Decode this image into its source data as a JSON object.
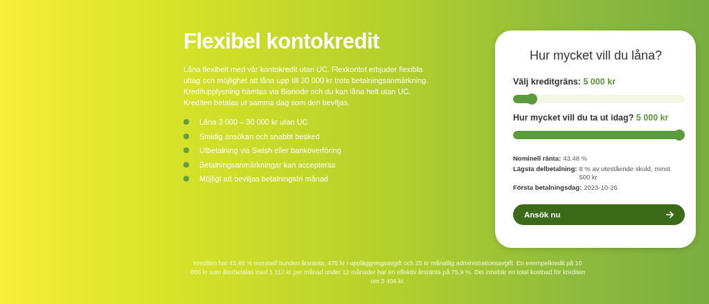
{
  "hero": {
    "title": "Flexibel kontokredit",
    "description": "Låna flexibelt med vår kontokredit utan UC. Flexkontot erbjuder flexibla uttag och möjlighet att låna upp till 30 000 kr trots betalningsanmärkning. Kreditupplysning hämtas via Bisnode och du kan låna helt utan UC. Krediten betalas ut samma dag som den beviljas.",
    "features": [
      "Låna 3 000 – 30 000 kr utan UC",
      "Smidig ansökan och snabbt besked",
      "Utbetalning via Swish eller banköverföring",
      "Betalningsanmärkningar kan accepteras",
      "Möjligt att beviljas betalningsfri månad"
    ]
  },
  "calculator": {
    "title": "Hur mycket vill du låna?",
    "sliders": [
      {
        "label": "Välj kreditgräns:",
        "value": "5 000 kr",
        "level": 0.08
      },
      {
        "label": "Hur mycket vill du ta ut idag?",
        "value": "5 000 kr",
        "level": 1
      }
    ],
    "details": [
      {
        "label": "Nominell ränta:",
        "value": "43.48 %"
      },
      {
        "label": "Lägsta delbetalning:",
        "value": "8 % av utestående skuld, minst 500 kr"
      },
      {
        "label": "Första betalningsdag:",
        "value": "2023-10-26"
      }
    ],
    "button": "Ansök nu"
  },
  "disclaimer": "Krediten har 43,48 % nominell bunden årsränta, 475 kr i uppläggningsavgift och 25 kr månatlig administrationsavgift. En exempelkredit på 10 000 kr som återbetalas med 1 117 kr per månad under 12 månader har en effektiv årsränta på 75,9 %. Det innebär en total kostnad för krediten om 3 404 kr."
}
